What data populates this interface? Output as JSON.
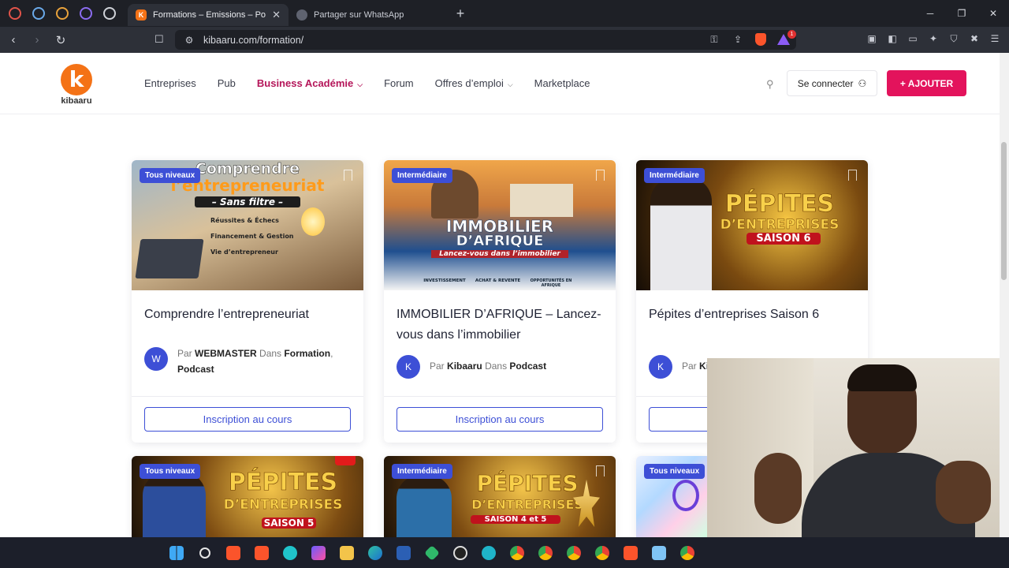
{
  "browser": {
    "tabs": [
      {
        "title": "Formations – Emissions – Podcast",
        "active": true
      },
      {
        "title": "Partager sur WhatsApp",
        "active": false
      }
    ],
    "url": "kibaaru.com/formation/",
    "alert_count": "1"
  },
  "site": {
    "logo_text": "kibaaru",
    "logo_letter": "k",
    "nav": [
      {
        "label": "Entreprises"
      },
      {
        "label": "Pub"
      },
      {
        "label": "Business Académie"
      },
      {
        "label": "Forum"
      },
      {
        "label": "Offres d’emploi"
      },
      {
        "label": "Marketplace"
      }
    ],
    "login_label": "Se connecter",
    "add_label": "+ AJOUTER"
  },
  "courses": [
    {
      "level": "Tous niveaux",
      "title": "Comprendre l’entrepreneuriat",
      "avatar": "W",
      "author": "WEBMASTER",
      "by": "Par",
      "in": "Dans",
      "category1": "Formation",
      "category2": "Podcast",
      "cta": "Inscription au cours",
      "banner_lines": [
        "Comprendre",
        "l’entrepreneuriat",
        "– Sans filtre –",
        "Réussites & Échecs",
        "Financement & Gestion",
        "Vie d’entrepreneur"
      ]
    },
    {
      "level": "Intermédiaire",
      "title": "IMMOBILIER D’AFRIQUE – Lancez-vous dans l’immobilier",
      "avatar": "K",
      "author": "Kibaaru",
      "by": "Par",
      "in": "Dans",
      "category1": "Podcast",
      "cta": "Inscription au cours",
      "banner_lines": [
        "IMMOBILIER",
        "D’AFRIQUE",
        "Lancez-vous dans l’immobilier",
        "INVESTISSEMENT",
        "ACHAT & REVENTE",
        "OPPORTUNITÉS EN AFRIQUE"
      ]
    },
    {
      "level": "Intermédiaire",
      "title": "Pépites d’entreprises Saison 6",
      "avatar": "K",
      "author": "Ki",
      "by": "Par",
      "cta": "Inscription au cours",
      "banner_lines": [
        "PÉPITES",
        "D’ENTREPRISES",
        "SAISON 6"
      ]
    },
    {
      "level": "Tous niveaux",
      "banner_lines": [
        "PÉPITES",
        "D’ENTREPRISES",
        "SAISON 5"
      ]
    },
    {
      "level": "Intermédiaire",
      "banner_lines": [
        "PÉPITES",
        "D’ENTREPRISES",
        "SAISON 4 et 5"
      ]
    },
    {
      "level": "Tous niveaux"
    }
  ],
  "colors": {
    "accent": "#e3135c",
    "brand_orange": "#f47216",
    "level_badge": "#3d4fd6"
  }
}
